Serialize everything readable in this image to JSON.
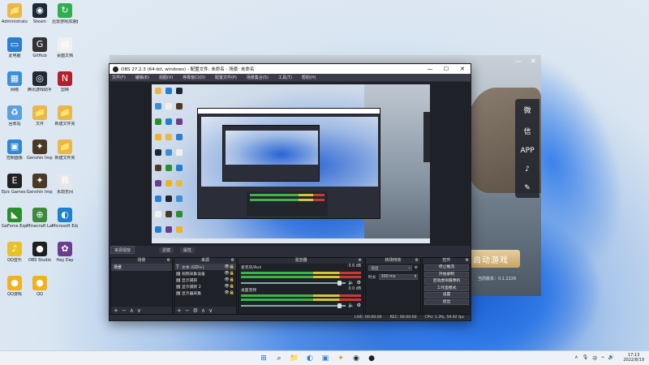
{
  "desktop": {
    "icons": [
      {
        "label": "Administrato",
        "glyph": "📁",
        "color": "#e8b84a"
      },
      {
        "label": "Steam",
        "glyph": "◉",
        "color": "#1b2838"
      },
      {
        "label": "迅雷游戏加速器",
        "glyph": "↻",
        "color": "#2fae4f"
      },
      {
        "label": "此电脑",
        "glyph": "▭",
        "color": "#2a7fd4"
      },
      {
        "label": "GitHub",
        "glyph": "G",
        "color": "#333333"
      },
      {
        "label": "桌面文档",
        "glyph": "▤",
        "color": "#f0f0f0"
      },
      {
        "label": "网络",
        "glyph": "▦",
        "color": "#3c8fd6"
      },
      {
        "label": "腾讯游戏助手",
        "glyph": "◎",
        "color": "#222a34"
      },
      {
        "label": "剪映",
        "glyph": "N",
        "color": "#b21f2d"
      },
      {
        "label": "回收站",
        "glyph": "♻",
        "color": "#5aa0df"
      },
      {
        "label": "文件",
        "glyph": "📁",
        "color": "#e8b84a"
      },
      {
        "label": "新建文件夹",
        "glyph": "📁",
        "color": "#e8b84a"
      },
      {
        "label": "控制面板",
        "glyph": "▣",
        "color": "#2f86d2"
      },
      {
        "label": "Genshin Impact",
        "glyph": "✦",
        "color": "#4a3a24"
      },
      {
        "label": "新建文件夹",
        "glyph": "📁",
        "color": "#e8b84a"
      },
      {
        "label": "Epic Games Launcher",
        "glyph": "E",
        "color": "#222222"
      },
      {
        "label": "Genshin Impact",
        "glyph": "✦",
        "color": "#4a3a24"
      },
      {
        "label": "永劫无间",
        "glyph": "弗",
        "color": "#e6e6e6"
      },
      {
        "label": "GeForce Experience",
        "glyph": "◣",
        "color": "#2a8f2a"
      },
      {
        "label": "Minecraft Launcher",
        "glyph": "⊕",
        "color": "#3d8a3d"
      },
      {
        "label": "Microsoft Edge",
        "glyph": "◐",
        "color": "#1f7fd0"
      },
      {
        "label": "QQ音乐",
        "glyph": "♪",
        "color": "#e8c02a"
      },
      {
        "label": "OBS Studio",
        "glyph": "●",
        "color": "#1f1f1f"
      },
      {
        "label": "Hay Day",
        "glyph": "✿",
        "color": "#6b3c8f"
      },
      {
        "label": "QQ游戏",
        "glyph": "●",
        "color": "#f2b21c"
      },
      {
        "label": "QQ",
        "glyph": "●",
        "color": "#f2b21c"
      }
    ]
  },
  "launcher": {
    "close_glyph": "✕",
    "min_glyph": "—",
    "rail": [
      "微",
      "信",
      "APP",
      "♪",
      "✎"
    ],
    "play_label": "启动游戏",
    "version": "当前版本：0.1.2226"
  },
  "obs": {
    "title": "OBS 27.2.3 (64-bit, windows) - 配置文件: 未命名 - 场景: 未命名",
    "menu": [
      "文件(F)",
      "编辑(E)",
      "视图(V)",
      "停靠窗口(D)",
      "配置文件(P)",
      "场景集合(S)",
      "工具(T)",
      "帮助(H)"
    ],
    "win_controls": [
      "—",
      "☐",
      "✕"
    ],
    "dock_tab": "来源视窗",
    "filter_buttons": [
      "滤镜",
      "属性"
    ],
    "panels": {
      "scenes": {
        "title": "场景",
        "items": [
          "场景"
        ]
      },
      "sources": {
        "title": "来源",
        "items": [
          {
            "type": "T",
            "name": "文本 (GDI+)"
          },
          {
            "type": "▤",
            "name": "视频采集设备"
          },
          {
            "type": "▤",
            "name": "显示捕获"
          },
          {
            "type": "▤",
            "name": "显示捕获 2"
          },
          {
            "type": "▤",
            "name": "显示器采集"
          }
        ]
      },
      "mixer": {
        "title": "混音器",
        "channels": [
          {
            "name": "麦克风/Aux",
            "db": "-3.6 dB"
          },
          {
            "name": "桌面音频",
            "db": "0.0 dB"
          }
        ]
      },
      "transitions": {
        "title": "转场特效",
        "type": "淡出",
        "duration_label": "时长",
        "duration": "300 ms"
      },
      "controls": {
        "title": "控件",
        "buttons": [
          "停止推流",
          "开始录制",
          "启动虚拟摄像机",
          "工作室模式",
          "设置",
          "退出"
        ]
      }
    },
    "footer_glyphs": [
      "+",
      "−",
      "∧",
      "∨"
    ],
    "sources_footer_glyphs": [
      "+",
      "−",
      "⚙",
      "∧",
      "∨"
    ],
    "status": {
      "live": "LIVE: 00:00:00",
      "rec": "REC: 00:00:00",
      "cpu": "CPU: 1.3%, 59.92 fps"
    }
  },
  "taskbar": {
    "apps": [
      {
        "glyph": "⊞",
        "color": "#1f6fd6",
        "name": "start"
      },
      {
        "glyph": "⌕",
        "color": "#222222",
        "name": "search"
      },
      {
        "glyph": "📁",
        "color": "#e8b84a",
        "name": "explorer"
      },
      {
        "glyph": "◐",
        "color": "#1f7fd0",
        "name": "edge"
      },
      {
        "glyph": "▣",
        "color": "#2f86d2",
        "name": "store"
      },
      {
        "glyph": "✦",
        "color": "#c99b3a",
        "name": "genshin"
      },
      {
        "glyph": "◉",
        "color": "#1b2838",
        "name": "steam"
      },
      {
        "glyph": "●",
        "color": "#1f1f1f",
        "name": "obs"
      }
    ],
    "tray": [
      "∧",
      "🎙",
      "中",
      "⌁",
      "🔊"
    ],
    "time": "17:13",
    "date": "2022/8/19"
  }
}
